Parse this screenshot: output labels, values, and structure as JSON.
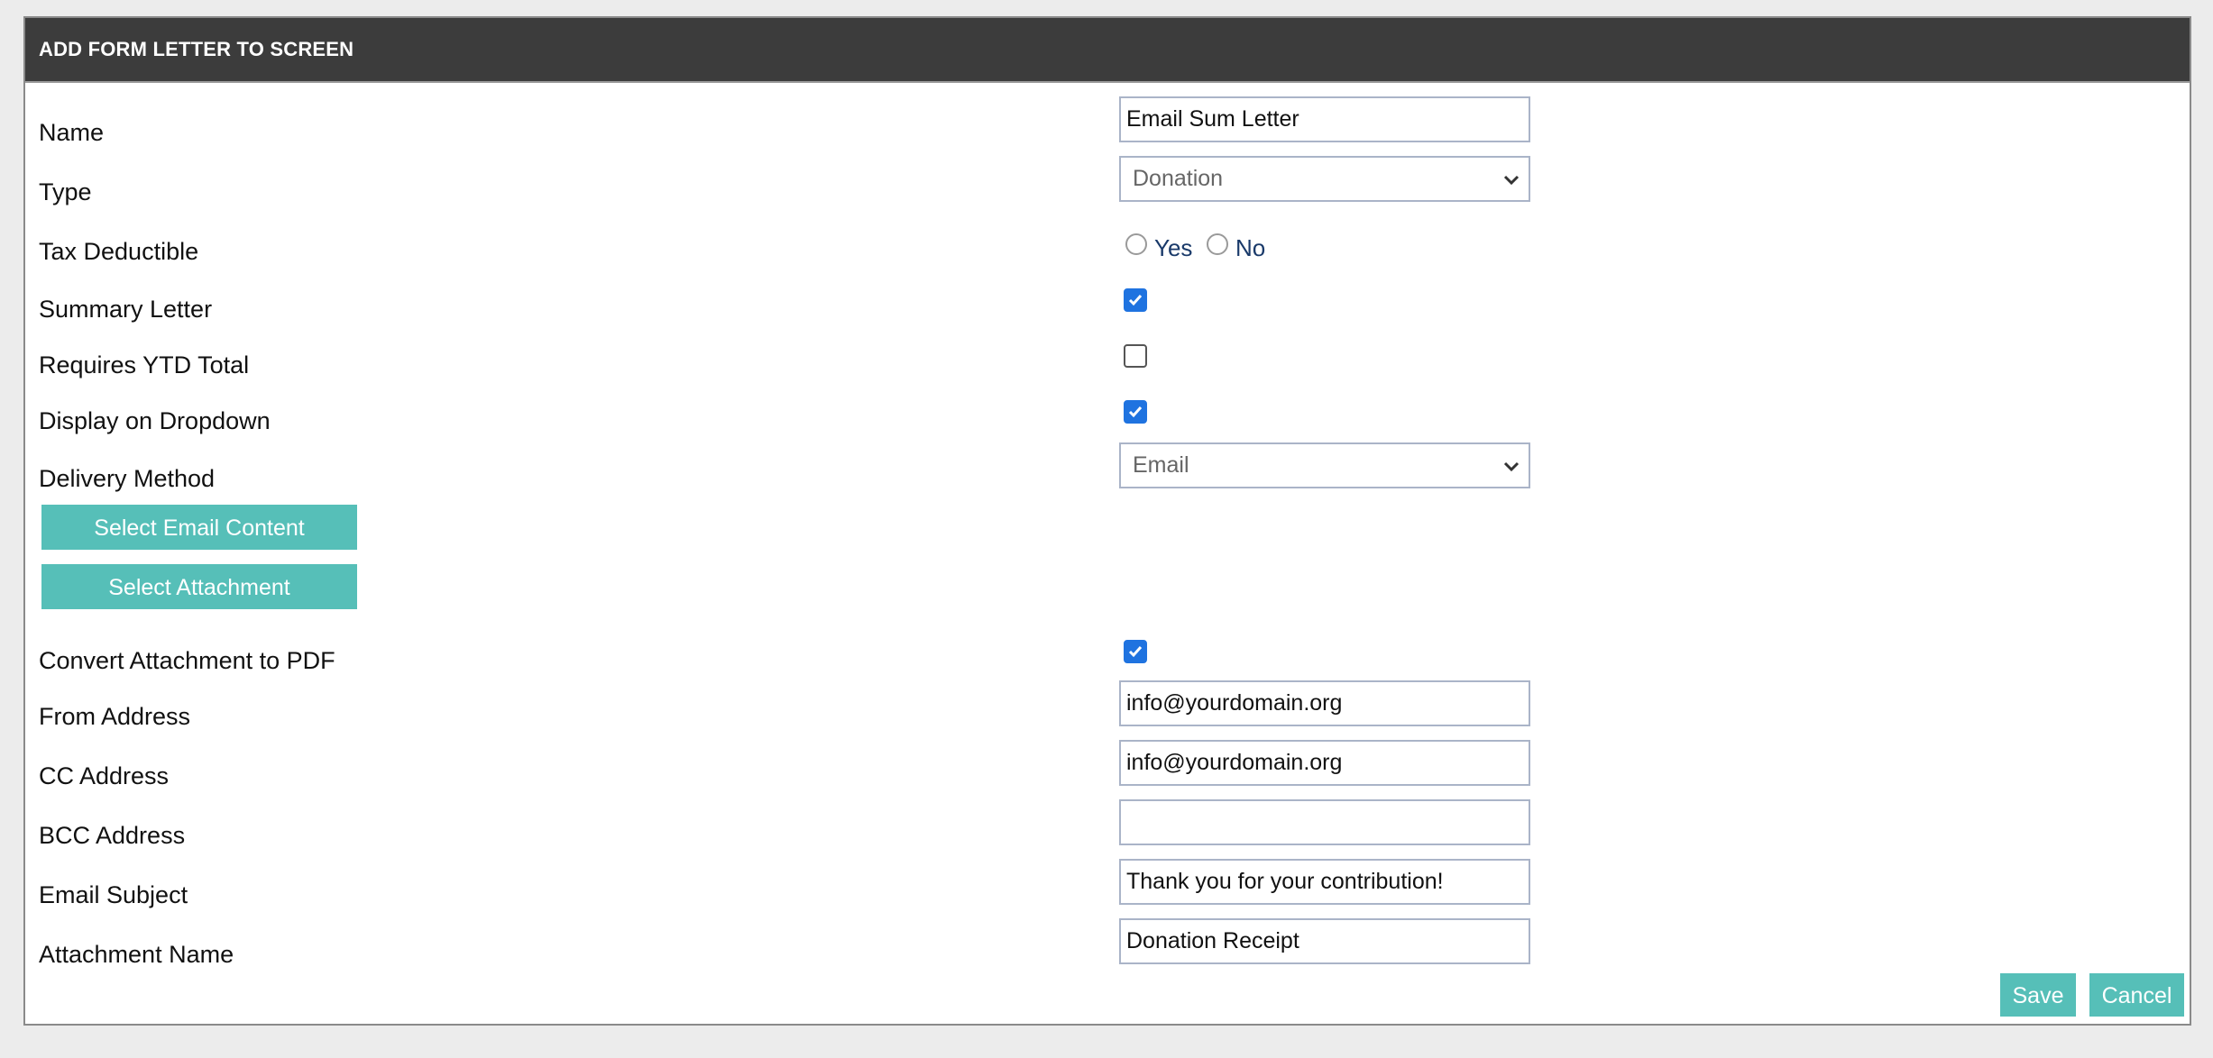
{
  "dialog": {
    "title": "ADD FORM LETTER TO SCREEN"
  },
  "form": {
    "name": {
      "label": "Name",
      "value": "Email Sum Letter"
    },
    "type": {
      "label": "Type",
      "selected": "Donation"
    },
    "tax_deductible": {
      "label": "Tax Deductible",
      "options": [
        "Yes",
        "No"
      ],
      "selected": null
    },
    "summary_letter": {
      "label": "Summary Letter",
      "checked": true
    },
    "requires_ytd_total": {
      "label": "Requires YTD Total",
      "checked": false
    },
    "display_on_dropdown": {
      "label": "Display on Dropdown",
      "checked": true
    },
    "delivery_method": {
      "label": "Delivery Method",
      "selected": "Email"
    },
    "select_email_content_label": "Select Email Content",
    "select_attachment_label": "Select Attachment",
    "convert_attachment_to_pdf": {
      "label": "Convert Attachment to PDF",
      "checked": true
    },
    "from_address": {
      "label": "From Address",
      "value": "info@yourdomain.org"
    },
    "cc_address": {
      "label": "CC Address",
      "value": "info@yourdomain.org"
    },
    "bcc_address": {
      "label": "BCC Address",
      "value": ""
    },
    "email_subject": {
      "label": "Email Subject",
      "value": "Thank you for your contribution!"
    },
    "attachment_name": {
      "label": "Attachment Name",
      "value": "Donation Receipt"
    }
  },
  "actions": {
    "save_label": "Save",
    "cancel_label": "Cancel"
  },
  "colors": {
    "header_bg": "#3c3c3c",
    "accent_teal": "#56bfb8",
    "checkbox_blue": "#1f73e0"
  },
  "icons": {
    "select_chevron": "chevron-down-icon",
    "checkmark": "checkmark-icon"
  }
}
